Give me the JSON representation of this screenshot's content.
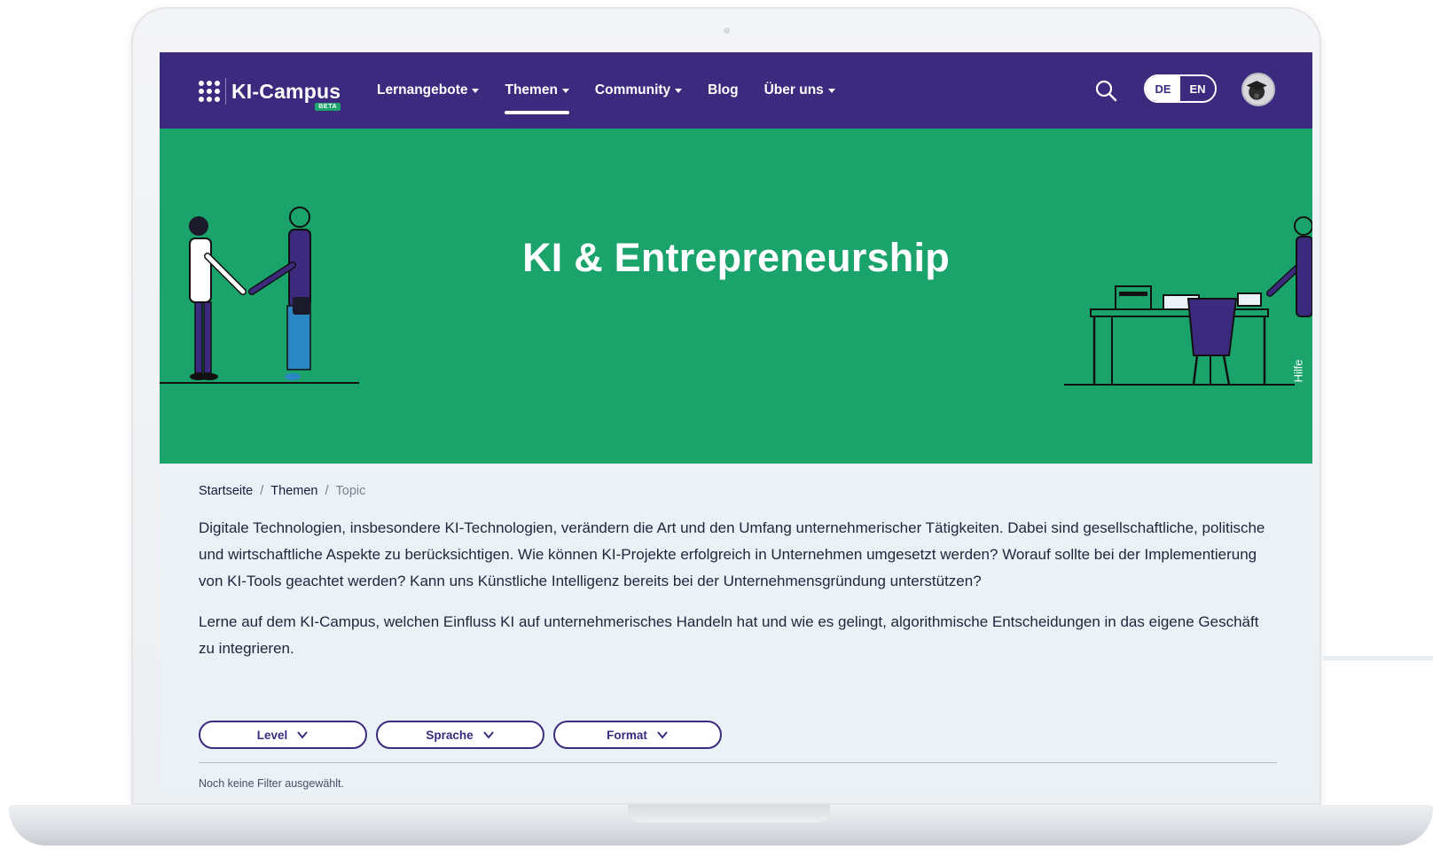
{
  "header": {
    "logo_text": "KI-Campus",
    "logo_badge": "BETA",
    "nav": [
      {
        "label": "Lernangebote",
        "has_dropdown": true,
        "active": false
      },
      {
        "label": "Themen",
        "has_dropdown": true,
        "active": true
      },
      {
        "label": "Community",
        "has_dropdown": true,
        "active": false
      },
      {
        "label": "Blog",
        "has_dropdown": false,
        "active": false
      },
      {
        "label": "Über uns",
        "has_dropdown": true,
        "active": false
      }
    ],
    "search_icon": "search-icon",
    "languages": [
      {
        "label": "DE",
        "selected": true
      },
      {
        "label": "EN",
        "selected": false
      }
    ],
    "avatar_icon": "user-avatar"
  },
  "hero": {
    "title": "KI & Entrepreneurship",
    "help_tab": "Hilfe",
    "background": "#1ba36c"
  },
  "breadcrumb": {
    "items": [
      "Startseite",
      "Themen",
      "Topic"
    ],
    "separator": "/"
  },
  "intro": {
    "paragraph1": "Digitale Technologien, insbesondere KI-Technologien, verändern die Art und den Umfang unternehmerischer Tätigkeiten. Dabei sind gesellschaftliche, politische und wirtschaftliche Aspekte zu berücksichtigen. Wie können KI-Projekte erfolgreich in Unternehmen umgesetzt werden? Worauf sollte bei der Implementierung von KI-Tools geachtet werden? Kann uns Künstliche Intelligenz bereits bei der Unternehmensgründung unterstützen?",
    "paragraph2": "Lerne auf dem KI-Campus, welchen Einfluss KI auf unternehmerisches Handeln hat und wie es gelingt, algorithmische Entscheidungen in das eigene Geschäft zu integrieren."
  },
  "filters": {
    "items": [
      {
        "label": "Level"
      },
      {
        "label": "Sprache"
      },
      {
        "label": "Format"
      }
    ],
    "status": "Noch keine Filter ausgewählt."
  },
  "colors": {
    "navbar": "#3b2a7e",
    "hero": "#1ba36c",
    "page_bg": "#eaf1f7",
    "accent": "#3b2a7e"
  }
}
